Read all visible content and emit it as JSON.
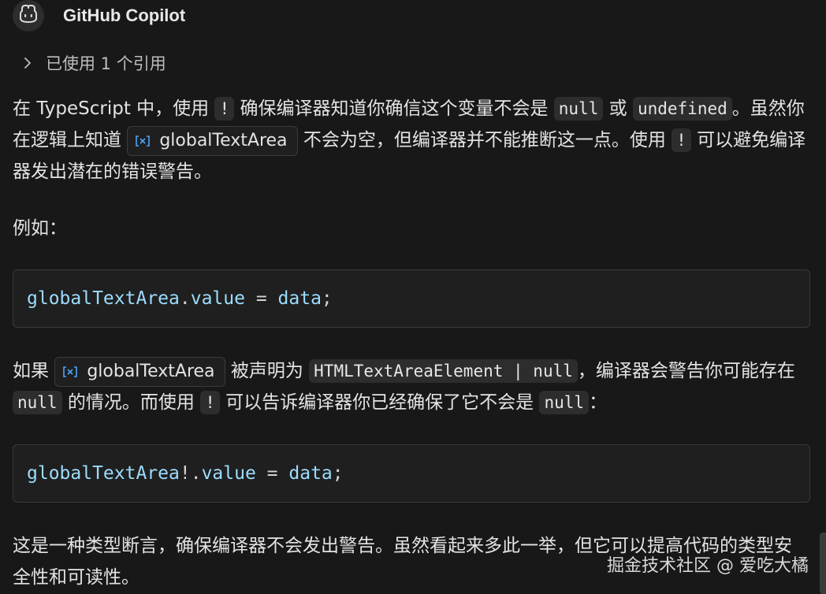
{
  "header": {
    "author": "GitHub Copilot",
    "avatar_icon": "copilot-icon"
  },
  "references": {
    "label": "已使用 1 个引用",
    "icon": "chevron-right-icon"
  },
  "paragraph1": {
    "t1": "在 TypeScript 中，使用 ",
    "c1": "!",
    "t2": " 确保编译器知道你确信这个变量不会是 ",
    "c2": "null",
    "t3": " 或 ",
    "c3": "undefined",
    "t4": "。虽然你在逻辑上知道 ",
    "ref": "globalTextArea",
    "t5": " 不会为空，但编译器并不能推断这一点。使用 ",
    "c4": "!",
    "t6": " 可以避免编译器发出潜在的错误警告。"
  },
  "paragraph2": {
    "text": "例如："
  },
  "code1": {
    "obj": "globalTextArea",
    "dot": ".",
    "prop": "value",
    "eq": " = ",
    "val": "data",
    "semi": ";"
  },
  "paragraph3": {
    "t1": "如果 ",
    "ref": "globalTextArea",
    "t2": " 被声明为 ",
    "c1": "HTMLTextAreaElement | null",
    "t3": "，编译器会警告你可能存在 ",
    "c2": "null",
    "t4": " 的情况。而使用 ",
    "c3": "!",
    "t5": " 可以告诉编译器你已经确保了它不会是 ",
    "c4": "null",
    "t6": "："
  },
  "code2": {
    "obj": "globalTextArea",
    "bang": "!.",
    "prop": "value",
    "eq": " = ",
    "val": "data",
    "semi": ";"
  },
  "paragraph4": {
    "text": "这是一种类型断言，确保编译器不会发出警告。虽然看起来多此一举，但它可以提高代码的类型安全性和可读性。"
  },
  "watermark": {
    "text": "掘金技术社区 @ 爱吃大橘"
  },
  "colors": {
    "background": "#181818",
    "text": "#e3e3e3",
    "code_identifier": "#9cdcfe",
    "inline_code_bg": "#2d2d2d",
    "symbol_icon": "#4fa3f7"
  }
}
